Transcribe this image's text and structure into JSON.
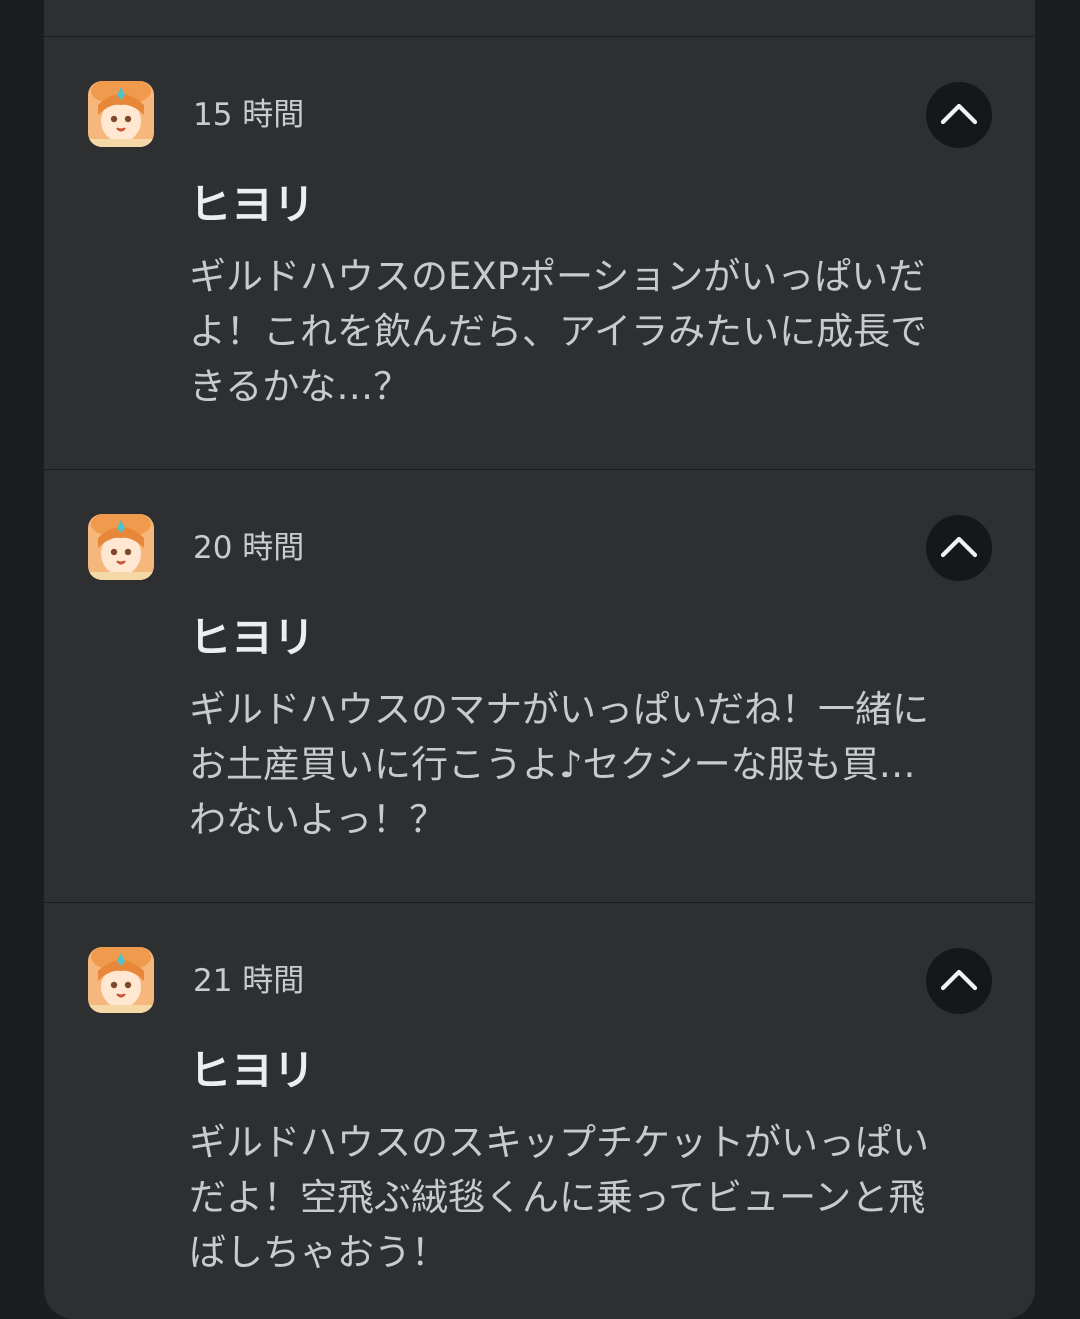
{
  "notifications": [
    {
      "time": "15 時間",
      "title": "ヒヨリ",
      "lines": [
        "ギルドハウスのEXPポーションがいっぱいだ",
        "よ！これを飲んだら、アイラみたいに成長で",
        "きるかな…？"
      ]
    },
    {
      "time": "20 時間",
      "title": "ヒヨリ",
      "lines": [
        "ギルドハウスのマナがいっぱいだね！一緒に",
        "お土産買いに行こうよ♪セクシーな服も買…",
        "わないよっ！？"
      ]
    },
    {
      "time": "21 時間",
      "title": "ヒヨリ",
      "lines": [
        "ギルドハウスのスキップチケットがいっぱい",
        "だよ！空飛ぶ絨毯くんに乗ってビューンと飛",
        "ばしちゃおう！"
      ]
    }
  ],
  "icons": {
    "app_icon": "hiyori-character-icon",
    "expand_icon": "chevron-up-icon"
  },
  "colors": {
    "background": "#1b1d1f",
    "card": "#2d2f31",
    "button": "#15181a",
    "title_text": "#eceef0",
    "body_text": "#c8cacc"
  }
}
